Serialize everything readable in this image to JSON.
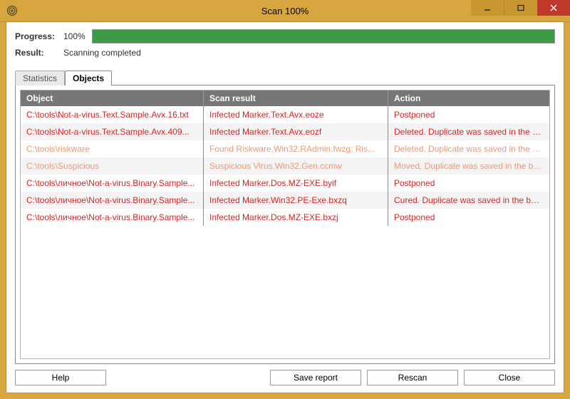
{
  "window": {
    "title": "Scan 100%"
  },
  "info": {
    "progress_label": "Progress:",
    "progress_pct_text": "100%",
    "progress_pct_value": 100,
    "result_label": "Result:",
    "result_text": "Scanning completed"
  },
  "tabs": {
    "statistics_label": "Statistics",
    "objects_label": "Objects",
    "active": "objects"
  },
  "columns": {
    "object": "Object",
    "scan_result": "Scan result",
    "action": "Action"
  },
  "rows": [
    {
      "style": "red",
      "object": "C:\\tools\\Not-a-virus.Text.Sample.Avx.16.txt",
      "result": "Infected Marker.Text.Avx.eoze",
      "action": "Postponed"
    },
    {
      "style": "red",
      "object": "C:\\tools\\Not-a-virus.Text.Sample.Avx.409...",
      "result": "Infected Marker.Text.Avx.eozf",
      "action": "Deleted. Duplicate was saved in the backup..."
    },
    {
      "style": "pale",
      "object": "C:\\tools\\riskware",
      "result": "Found Riskware.Win32.RAdmin.fwzg; Ris...",
      "action": "Deleted. Duplicate was saved in the backup..."
    },
    {
      "style": "pale",
      "object": "C:\\tools\\Suspicious",
      "result": "Suspicious Virus.Win32.Gen.ccmw",
      "action": "Moved. Duplicate was saved in the backup ..."
    },
    {
      "style": "red",
      "object": "C:\\tools\\личное\\Not-a-virus.Binary.Sample...",
      "result": "Infected Marker.Dos.MZ-EXE.byif",
      "action": "Postponed"
    },
    {
      "style": "red",
      "object": "C:\\tools\\личное\\Not-a-virus.Binary.Sample...",
      "result": "Infected Marker.Win32.PE-Exe.bxzq",
      "action": "Cured. Duplicate was saved in the backup s..."
    },
    {
      "style": "red",
      "object": "C:\\tools\\личное\\Not-a-virus.Binary.Sample...",
      "result": "Infected Marker.Dos.MZ-EXE.bxzj",
      "action": "Postponed"
    }
  ],
  "buttons": {
    "help": "Help",
    "save_report": "Save report",
    "rescan": "Rescan",
    "close": "Close"
  },
  "icons": {
    "app": "spiral-icon",
    "minimize": "minimize-icon",
    "maximize": "maximize-icon",
    "close": "close-icon"
  }
}
